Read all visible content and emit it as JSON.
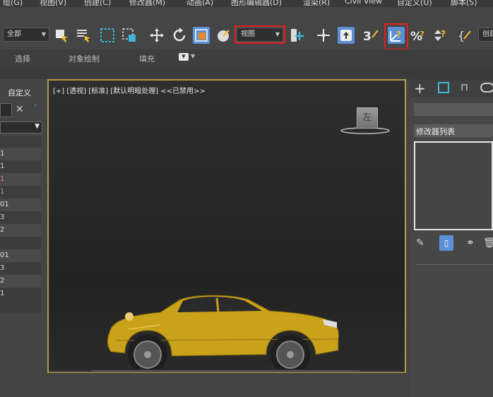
{
  "menubar": {
    "items": [
      "组(G)",
      "视图(V)",
      "创建(C)",
      "修改器(M)",
      "动画(A)",
      "图形编辑器(D)",
      "渲染(R)",
      "Civil View",
      "自定义(U)",
      "脚本(S)"
    ]
  },
  "toolbar": {
    "filter_dropdown": "全部",
    "coord_dropdown": "视图",
    "create_selection_label": "创建"
  },
  "ribbon": {
    "tabs": [
      "选择",
      "对象绘制",
      "填充"
    ]
  },
  "left_panel": {
    "header": "自定义",
    "rows": [
      "1",
      "1",
      "1",
      "1",
      "01",
      "3",
      "2",
      "",
      "01",
      "3",
      "2",
      "1"
    ]
  },
  "viewport": {
    "label": "[+] [透视] [标准] [默认明暗处理] <<已禁用>>",
    "viewcube_face": "左"
  },
  "right_panel": {
    "modifier_list_label": "修改器列表"
  },
  "colors": {
    "highlight_red": "#e02020",
    "viewport_border": "#b89a44",
    "active_blue": "#5b8fd6",
    "car_yellow": "#c9a21a"
  }
}
